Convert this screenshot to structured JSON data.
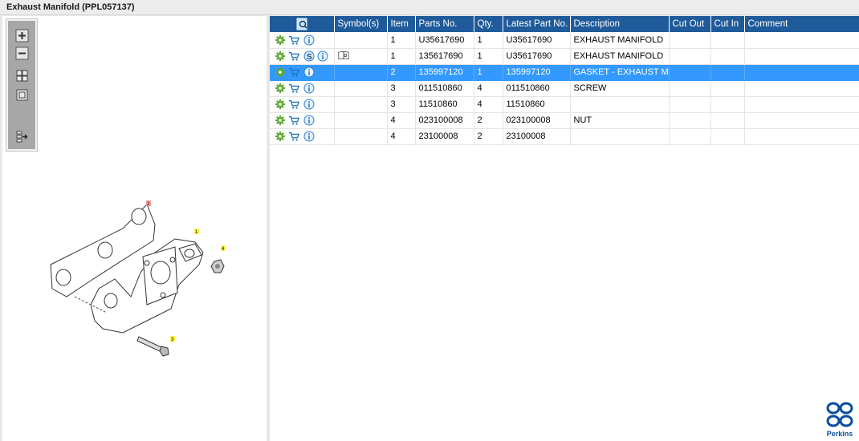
{
  "window": {
    "title": "Exhaust Manifold (PPL057137)"
  },
  "toolbar": {
    "zoom_in_icon": "plus-icon",
    "zoom_out_icon": "minus-icon",
    "grid_view_icon": "grid-icon",
    "single_view_icon": "square-icon",
    "export_icon": "export-icon"
  },
  "diagram": {
    "callouts": [
      "2",
      "1",
      "4",
      "3"
    ]
  },
  "table": {
    "columns": [
      "",
      "Symbol(s)",
      "Item",
      "Parts No.",
      "Qty.",
      "Latest Part No.",
      "Description",
      "Cut Out",
      "Cut In",
      "Comment"
    ],
    "rows": [
      {
        "item": "1",
        "part_no": "U35617690",
        "qty": "1",
        "latest": "U35617690",
        "desc": "EXHAUST MANIFOLD",
        "cut_out": "",
        "cut_in": "",
        "comment": "",
        "has_s": false,
        "has_symbol": false
      },
      {
        "item": "1",
        "part_no": "135617690",
        "qty": "1",
        "latest": "U35617690",
        "desc": "EXHAUST MANIFOLD",
        "cut_out": "",
        "cut_in": "",
        "comment": "",
        "has_s": true,
        "has_symbol": true
      },
      {
        "item": "2",
        "part_no": "135997120",
        "qty": "1",
        "latest": "135997120",
        "desc": "GASKET - EXHAUST MANIFOLD",
        "cut_out": "",
        "cut_in": "",
        "comment": "",
        "has_s": false,
        "has_symbol": false,
        "selected": true
      },
      {
        "item": "3",
        "part_no": "011510860",
        "qty": "4",
        "latest": "011510860",
        "desc": "SCREW",
        "cut_out": "",
        "cut_in": "",
        "comment": "",
        "has_s": false,
        "has_symbol": false
      },
      {
        "item": "3",
        "part_no": "11510860",
        "qty": "4",
        "latest": "11510860",
        "desc": "",
        "cut_out": "",
        "cut_in": "",
        "comment": "",
        "has_s": false,
        "has_symbol": false
      },
      {
        "item": "4",
        "part_no": "023100008",
        "qty": "2",
        "latest": "023100008",
        "desc": "NUT",
        "cut_out": "",
        "cut_in": "",
        "comment": "",
        "has_s": false,
        "has_symbol": false
      },
      {
        "item": "4",
        "part_no": "23100008",
        "qty": "2",
        "latest": "23100008",
        "desc": "",
        "cut_out": "",
        "cut_in": "",
        "comment": "",
        "has_s": false,
        "has_symbol": false
      }
    ]
  },
  "brand": {
    "name": "Perkins",
    "color": "#0a4f9e"
  },
  "colors": {
    "header": "#1f5b9a",
    "selected": "#3399ff",
    "gear": "#5aa82b",
    "cart": "#1c6fbf",
    "info": "#2a7fd4"
  }
}
